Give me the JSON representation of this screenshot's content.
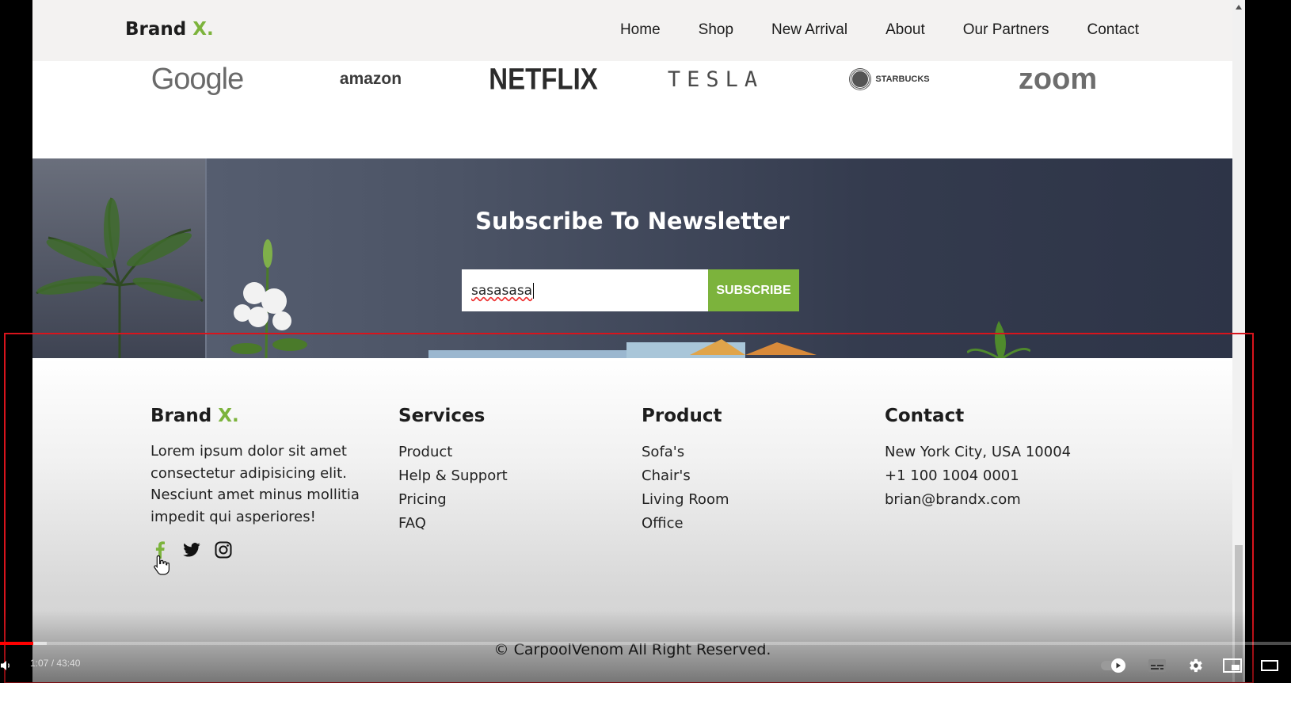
{
  "nav": {
    "logo_brand": "Brand",
    "logo_accent": "X.",
    "items": [
      {
        "label": "Home"
      },
      {
        "label": "Shop"
      },
      {
        "label": "New Arrival"
      },
      {
        "label": "About"
      },
      {
        "label": "Our Partners"
      },
      {
        "label": "Contact"
      }
    ]
  },
  "partners": {
    "logos": [
      "Google",
      "amazon",
      "NETFLIX",
      "TESLA",
      "STARBUCKS",
      "zoom"
    ]
  },
  "newsletter": {
    "title": "Subscribe To Newsletter",
    "email_value": "sasasasa",
    "button_label": "SUBSCRIBE"
  },
  "footer": {
    "brand": "Brand",
    "brand_accent": "X.",
    "description": "Lorem ipsum dolor sit amet consectetur adipisicing elit. Nesciunt amet minus mollitia impedit qui asperiores!",
    "services": {
      "title": "Services",
      "items": [
        "Product",
        "Help & Support",
        "Pricing",
        "FAQ"
      ]
    },
    "product": {
      "title": "Product",
      "items": [
        "Sofa's",
        "Chair's",
        "Living Room",
        "Office"
      ]
    },
    "contact": {
      "title": "Contact",
      "items": [
        "New York City, USA 10004",
        "+1 100 1004 0001",
        "brian@brandx.com"
      ]
    },
    "social_icons": [
      "facebook-icon",
      "twitter-icon",
      "instagram-icon"
    ],
    "copyright": "© CarpoolVenom All Right Reserved."
  },
  "video": {
    "time": "1:07 / 43:40",
    "progress_fraction": 0.026
  },
  "colors": {
    "accent": "#7cb33c",
    "banner_dark": "#2d3447",
    "highlight": "#d8141c"
  }
}
